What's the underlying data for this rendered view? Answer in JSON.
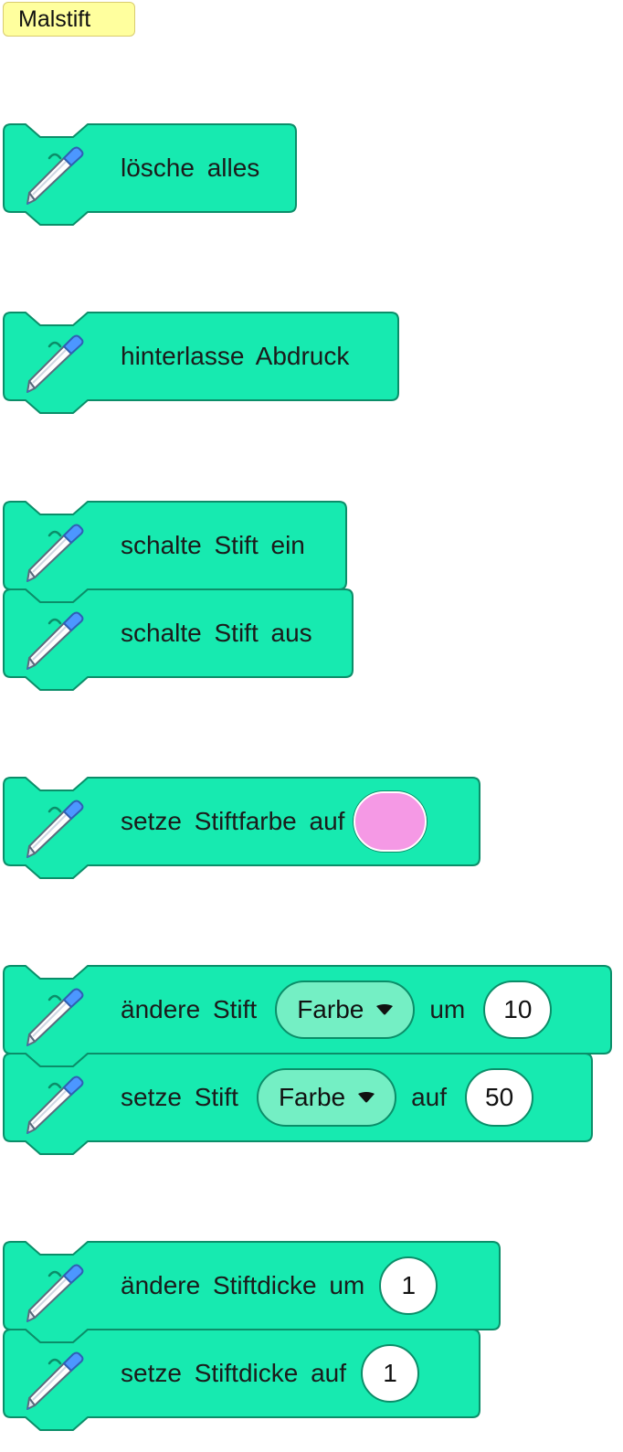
{
  "category": {
    "label": "Malstift"
  },
  "colors": {
    "block_fill": "#17eab0",
    "block_stroke": "#0b8e69",
    "pen_color_value": "#f599e5",
    "dropdown_fill": "#74efc4"
  },
  "blocks": {
    "clear": {
      "text": "lösche alles"
    },
    "stamp": {
      "text": "hinterlasse Abdruck"
    },
    "pen_down": {
      "text": "schalte Stift ein"
    },
    "pen_up": {
      "text": "schalte Stift aus"
    },
    "set_color": {
      "text": "setze Stiftfarbe auf",
      "value_icon": "color-swatch"
    },
    "change_param": {
      "prefix": "ändere Stift",
      "dropdown": "Farbe",
      "middle": "um",
      "value": "10"
    },
    "set_param": {
      "prefix": "setze Stift",
      "dropdown": "Farbe",
      "middle": "auf",
      "value": "50"
    },
    "change_size": {
      "text": "ändere Stiftdicke um",
      "value": "1"
    },
    "set_size": {
      "text": "setze Stiftdicke auf",
      "value": "1"
    }
  },
  "icons": {
    "block_icon": "pen-icon",
    "dropdown_icon": "caret-down-icon"
  }
}
